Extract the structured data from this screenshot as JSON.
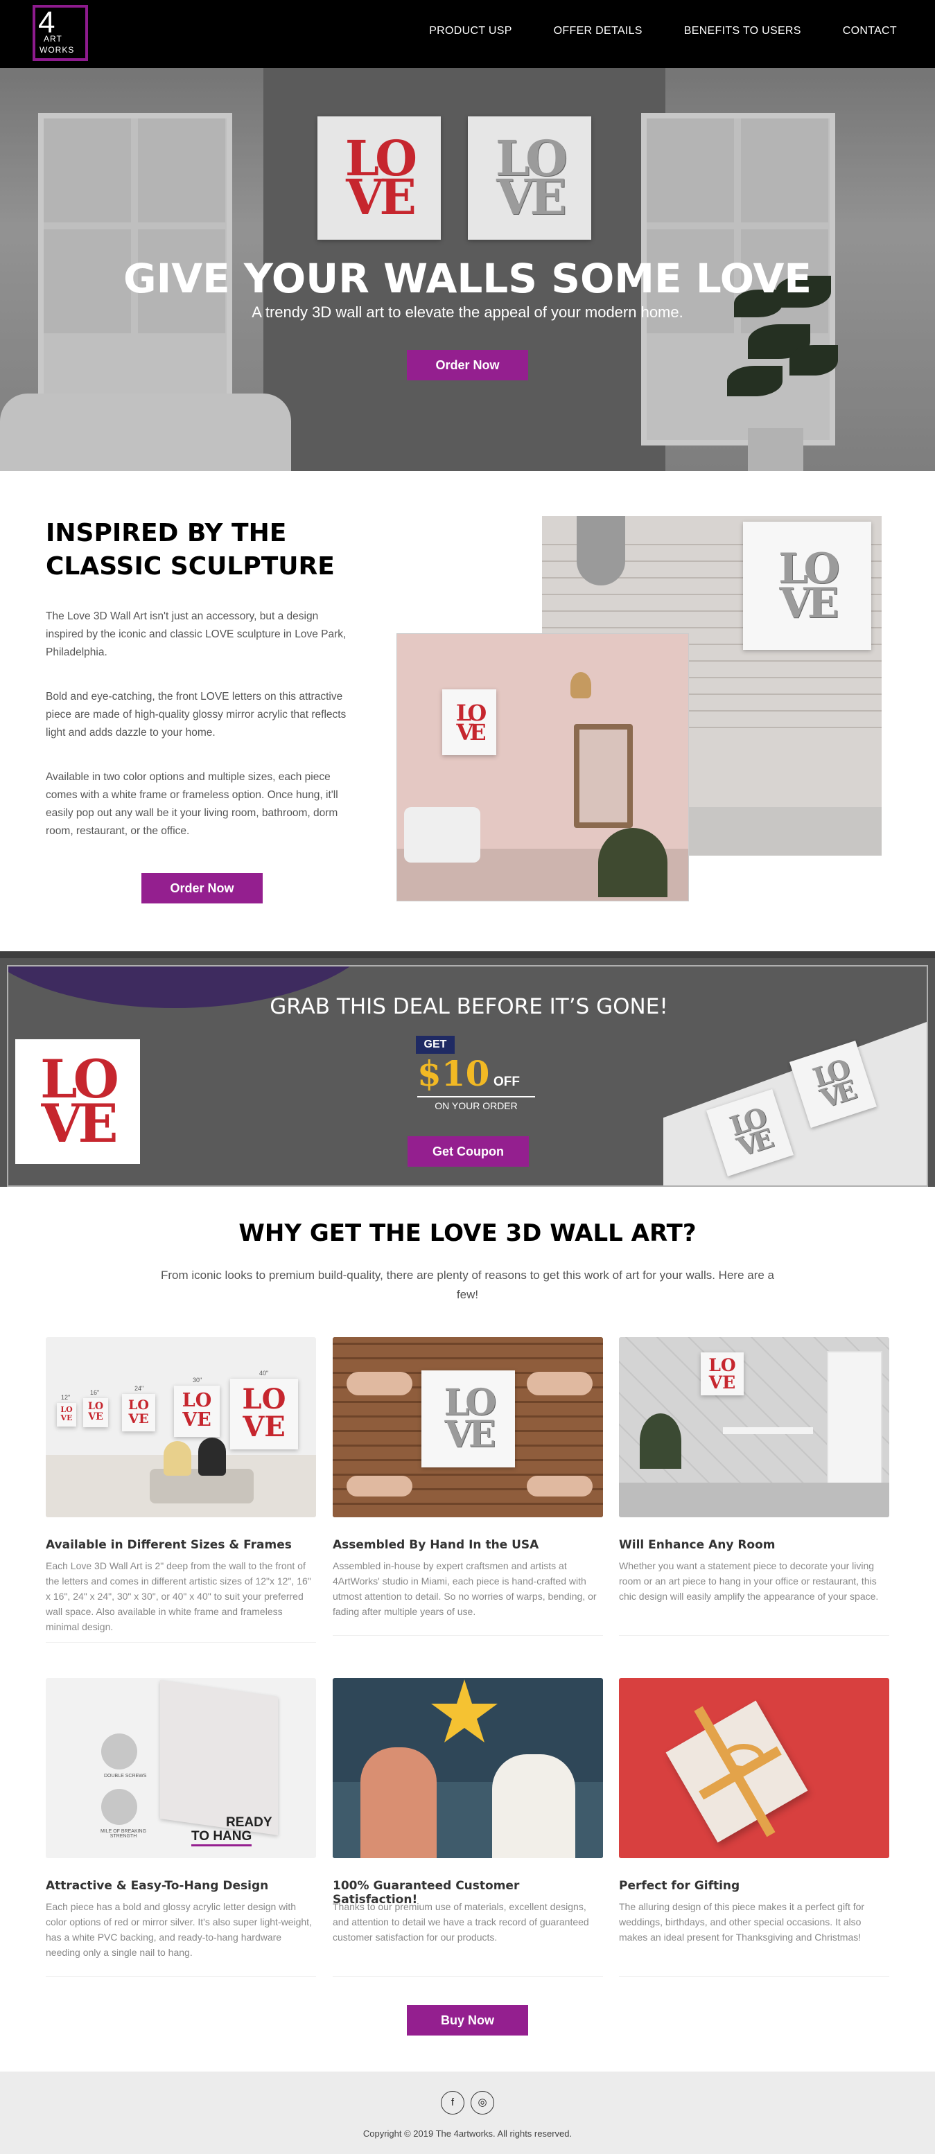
{
  "brand": {
    "logo_number": "4",
    "logo_line1": "ART",
    "logo_line2": "WORKS"
  },
  "nav": {
    "items": [
      "PRODUCT USP",
      "OFFER DETAILS",
      "BENEFITS TO USERS",
      "CONTACT"
    ]
  },
  "hero": {
    "title": "GIVE YOUR WALLS SOME LOVE",
    "subtitle": "A trendy 3D wall art to elevate the appeal of your modern home.",
    "cta": "Order Now",
    "art_letters": {
      "row1": "LO",
      "row2": "VE"
    }
  },
  "inspired": {
    "title_line1": "INSPIRED BY THE",
    "title_line2": "CLASSIC SCULPTURE",
    "paragraphs": [
      "The Love 3D Wall Art isn't just an accessory, but a design inspired by the iconic and classic LOVE sculpture in Love Park, Philadelphia.",
      "Bold and eye-catching, the front LOVE letters on this attractive piece are made of high-quality glossy mirror acrylic that reflects light and adds dazzle to your home.",
      "Available in two color options and multiple sizes, each piece comes with a white frame or frameless option. Once hung, it'll easily pop out any wall be it your living room, bathroom, dorm room, restaurant, or the office."
    ],
    "cta": "Order Now"
  },
  "deal": {
    "title": "GRAB THIS DEAL BEFORE IT’S GONE!",
    "get": "GET",
    "amount": "$10",
    "off": "OFF",
    "on_order": "ON YOUR ORDER",
    "cta": "Get Coupon"
  },
  "why": {
    "title": "WHY GET THE LOVE 3D WALL ART?",
    "intro": "From iconic looks to premium build-quality, there are plenty of reasons to get this work of art for your walls. Here are a few!",
    "cards": [
      {
        "title": "Available in Different Sizes & Frames",
        "text": "Each Love 3D Wall Art is 2\" deep from the wall to the front of the letters and comes in different artistic sizes of 12\"x 12\", 16\" x 16\", 24\" x 24\", 30\" x 30\", or 40\" x 40\" to suit your preferred wall space. Also available in white frame and frameless minimal design."
      },
      {
        "title": "Assembled By Hand In the USA",
        "text": "Assembled in-house by expert craftsmen and artists at 4ArtWorks' studio in Miami, each piece is hand-crafted with utmost attention to detail. So no worries of warps, bending, or fading after multiple years of use."
      },
      {
        "title": "Will Enhance Any Room",
        "text": "Whether you want a statement piece to decorate your living room or an art piece to hang in your office or restaurant, this chic design will easily amplify the appearance of your space."
      },
      {
        "title": "Attractive & Easy-To-Hang Design",
        "text": "Each piece has a bold and glossy acrylic letter design with color options of red or mirror silver. It's also super light-weight, has a white PVC backing, and ready-to-hang hardware needing only a single nail to hang."
      },
      {
        "title": "100% Guaranteed Customer Satisfaction!",
        "text": "Thanks to our premium use of materials, excellent designs, and attention to detail we have a track record of guaranteed customer satisfaction for our products."
      },
      {
        "title": "Perfect for Gifting",
        "text": "The alluring design of this piece makes it a perfect gift for weddings, birthdays, and other special occasions. It also makes an ideal present for Thanksgiving and Christmas!"
      }
    ],
    "size_labels": [
      "12\"",
      "16\"",
      "24\"",
      "30\"",
      "40\""
    ],
    "hang_labels": {
      "screws": "DOUBLE SCREWS",
      "strength": "MILE OF BREAKING STRENGTH",
      "ready1": "READY",
      "ready2": "TO HANG"
    },
    "cta": "Buy Now"
  },
  "footer": {
    "social": [
      {
        "icon": "facebook-icon",
        "glyph": "f"
      },
      {
        "icon": "instagram-icon",
        "glyph": "◎"
      }
    ],
    "copyright": "Copyright © 2019 The 4artworks. All rights reserved."
  },
  "colors": {
    "accent": "#941f8f",
    "love_red": "#c6262e",
    "nav_bg": "#000000",
    "gold": "#f2b924",
    "navy": "#1f2a63"
  }
}
